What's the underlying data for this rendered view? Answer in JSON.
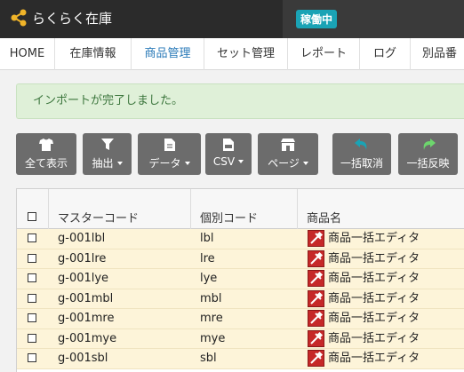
{
  "header": {
    "app_title": "らくらく在庫",
    "status_badge": "稼働中"
  },
  "nav": {
    "items": [
      "HOME",
      "在庫情報",
      "商品管理",
      "セット管理",
      "レポート",
      "ログ",
      "別品番"
    ],
    "active_index": 2
  },
  "alert": {
    "message": "インポートが完了しました。"
  },
  "toolbar": {
    "buttons": [
      {
        "label": "全て表示",
        "icon": "shirt-icon",
        "dropdown": false
      },
      {
        "label": "抽出",
        "icon": "filter-icon",
        "dropdown": true
      },
      {
        "label": "データ",
        "icon": "document-icon",
        "dropdown": true
      },
      {
        "label": "CSV",
        "icon": "csv-file-icon",
        "dropdown": true
      },
      {
        "label": "ページ",
        "icon": "store-icon",
        "dropdown": true
      },
      {
        "label": "一括取消",
        "icon": "undo-icon",
        "dropdown": false
      },
      {
        "label": "一括反映",
        "icon": "redo-icon",
        "dropdown": false
      }
    ]
  },
  "table": {
    "columns": [
      "マスターコード",
      "個別コード",
      "商品名"
    ],
    "rows": [
      {
        "master_code": "g-001lbl",
        "item_code": "lbl",
        "product_name": "商品一括エディタ"
      },
      {
        "master_code": "g-001lre",
        "item_code": "lre",
        "product_name": "商品一括エディタ"
      },
      {
        "master_code": "g-001lye",
        "item_code": "lye",
        "product_name": "商品一括エディタ"
      },
      {
        "master_code": "g-001mbl",
        "item_code": "mbl",
        "product_name": "商品一括エディタ"
      },
      {
        "master_code": "g-001mre",
        "item_code": "mre",
        "product_name": "商品一括エディタ"
      },
      {
        "master_code": "g-001mye",
        "item_code": "mye",
        "product_name": "商品一括エディタ"
      },
      {
        "master_code": "g-001sbl",
        "item_code": "sbl",
        "product_name": "商品一括エディタ"
      }
    ]
  },
  "colors": {
    "topbar": "#2b2b2b",
    "badge": "#1aa3b5",
    "nav_active": "#2a7ab8",
    "alert_bg": "#dff0d8",
    "alert_text": "#3c763d",
    "button_bg": "#6c6c6c",
    "undo_icon": "#1aa3b5",
    "redo_icon": "#6dd66d",
    "row_bg": "#fdf4d9"
  }
}
